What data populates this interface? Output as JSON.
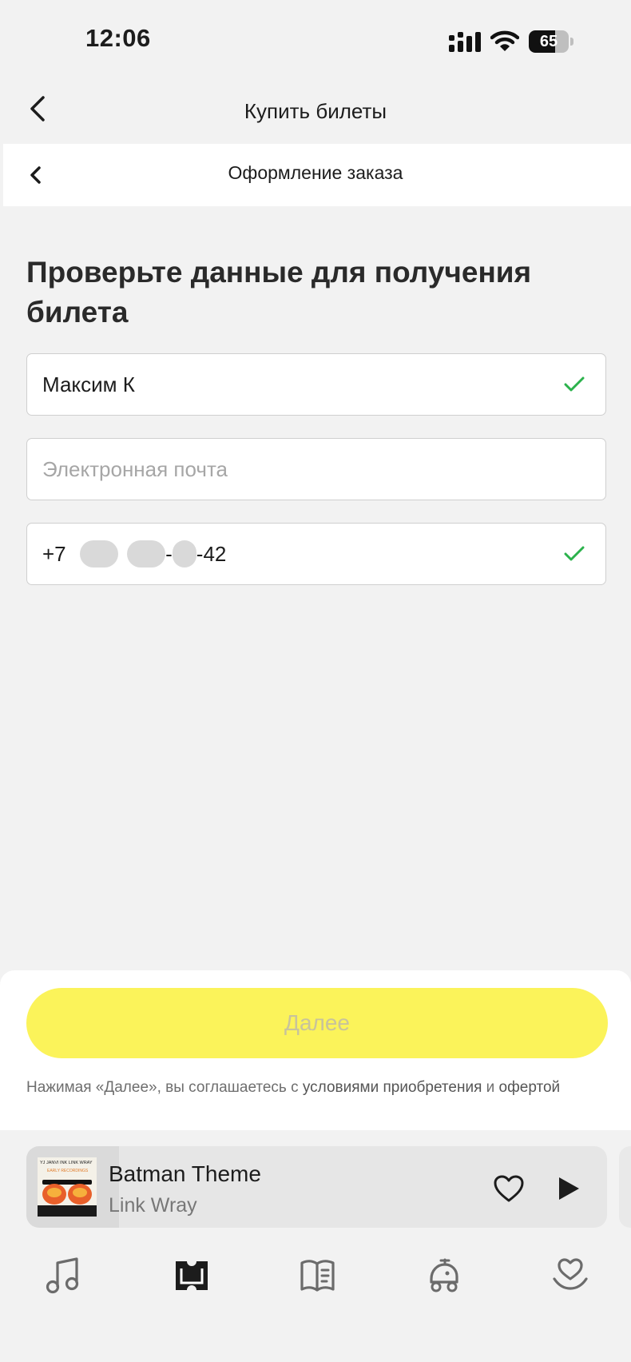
{
  "status_bar": {
    "time": "12:06",
    "battery": "65",
    "battery_level": 0.65
  },
  "nav": {
    "title": "Купить билеты"
  },
  "subheader": {
    "title": "Оформление заказа"
  },
  "form": {
    "heading": "Проверьте данные для получения билета",
    "name_value": "Максим К",
    "email_placeholder": "Электронная почта",
    "phone_prefix": "+7",
    "phone_sep1": "-",
    "phone_sep2": "-",
    "phone_suffix": "-42"
  },
  "next_button": {
    "label": "Далее"
  },
  "terms": {
    "text": "Нажимая «Далее», вы соглашаетесь с ",
    "link1": "условиями приобретения",
    "middle": " и ",
    "link2": "офертой"
  },
  "player": {
    "title": "Batman Theme",
    "artist": "Link Wray",
    "progress": 0.16,
    "cover_text_top": "YJ JANVI INK LINK WRAY",
    "cover_text_sub": "EARLY RECORDINGS"
  },
  "tabs": [
    {
      "icon": "music-note-icon"
    },
    {
      "icon": "ticket-icon"
    },
    {
      "icon": "book-icon"
    },
    {
      "icon": "kids-icon"
    },
    {
      "icon": "heart-hand-icon"
    }
  ],
  "colors": {
    "accent": "#fbf35a",
    "check": "#2bb24c"
  }
}
